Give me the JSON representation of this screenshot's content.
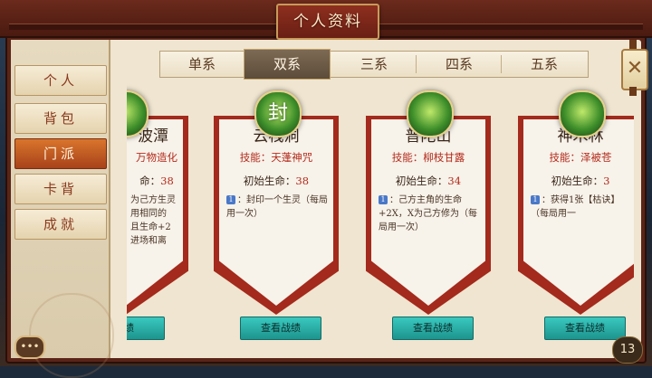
{
  "window": {
    "title": "个人资料"
  },
  "sidebar": {
    "items": [
      {
        "label": "个人",
        "active": false
      },
      {
        "label": "背包",
        "active": false
      },
      {
        "label": "门派",
        "active": true
      },
      {
        "label": "卡背",
        "active": false
      },
      {
        "label": "成就",
        "active": false
      }
    ]
  },
  "tabs": [
    {
      "label": "单系",
      "active": false
    },
    {
      "label": "双系",
      "active": true
    },
    {
      "label": "三系",
      "active": false
    },
    {
      "label": "四系",
      "active": false
    },
    {
      "label": "五系",
      "active": false
    }
  ],
  "cards": [
    {
      "name": "碧波潭",
      "name_visible": "波潭",
      "emblem_icon": "nature-sect-icon",
      "skill": "万物造化",
      "hp_label": "命：",
      "hp_value": "38",
      "desc_lines": [
        "为己方生灵",
        "用相同的",
        "且生命+2",
        "进场和离"
      ],
      "record_label": "战绩"
    },
    {
      "name": "云栈洞",
      "emblem_icon": "seal-sect-icon",
      "emblem_text": "封",
      "skill": "技能：天蓬神咒",
      "hp_label": "初始生命：",
      "hp_value": "38",
      "desc": "：封印一个生灵（每局用一次）",
      "record_label": "查看战绩"
    },
    {
      "name": "普陀山",
      "emblem_icon": "willow-sect-icon",
      "skill": "技能：柳枝甘露",
      "hp_label": "初始生命：",
      "hp_value": "34",
      "desc": "：己方主角的生命+2X，X为己方修为（每局用一次）",
      "record_label": "查看战绩"
    },
    {
      "name": "神木林",
      "emblem_icon": "tree-sect-icon",
      "skill": "技能：泽被苍",
      "hp_label": "初始生命：",
      "hp_value": "3",
      "desc": "：获得1张【枯诀】（每局用一",
      "record_label": "查看战绩"
    }
  ],
  "badge_count": "13",
  "close_icon": "close-icon",
  "chat_icon": "chat-bubble-icon",
  "colors": {
    "accent_red": "#a32a1c",
    "active_tab": "#5d4c3a",
    "active_side": "#d9752c",
    "record_button": "#39c9c0"
  }
}
